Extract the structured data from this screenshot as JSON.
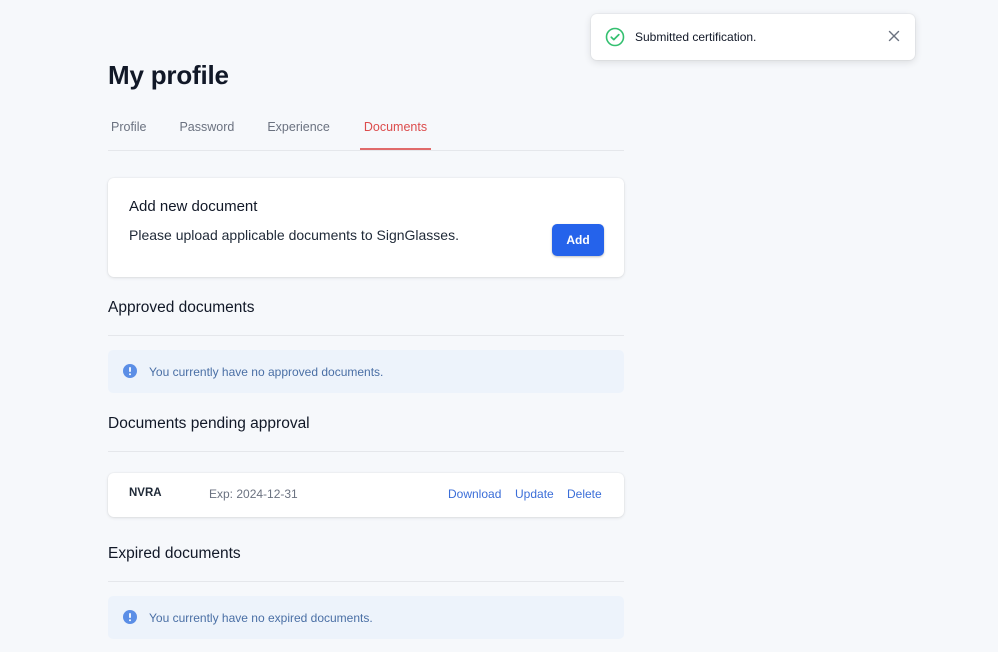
{
  "page": {
    "title": "My profile"
  },
  "tabs": [
    {
      "label": "Profile"
    },
    {
      "label": "Password"
    },
    {
      "label": "Experience"
    },
    {
      "label": "Documents",
      "active": true
    }
  ],
  "add_document": {
    "title": "Add new document",
    "description": "Please upload applicable documents to SignGlasses.",
    "button_label": "Add"
  },
  "approved": {
    "heading": "Approved documents",
    "empty_message": "You currently have no approved documents.",
    "icon": "info-icon"
  },
  "pending": {
    "heading": "Documents pending approval",
    "rows": [
      {
        "name": "NVRA",
        "expiry": "Exp: 2024-12-31",
        "actions": {
          "download": "Download",
          "update": "Update",
          "delete": "Delete"
        }
      }
    ]
  },
  "expired": {
    "heading": "Expired documents",
    "empty_message": "You currently have no expired documents.",
    "icon": "info-icon"
  },
  "toast": {
    "message": "Submitted certification.",
    "icon": "check-circle-icon",
    "close_icon": "close-icon"
  },
  "colors": {
    "accent": "#2563eb",
    "active_tab": "#dc4c4c",
    "link": "#3b6ed8",
    "notice_bg": "#edf3fb",
    "success": "#34c070"
  }
}
